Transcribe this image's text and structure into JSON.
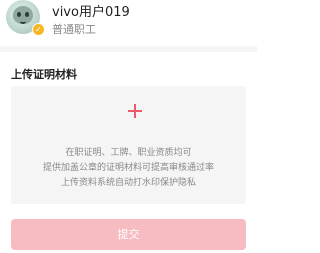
{
  "profile": {
    "username": "vivo用户019",
    "role": "普通职工",
    "avatar_icon": "cartoon-avatar",
    "verify_badge_icon": "verified-badge-icon"
  },
  "upload": {
    "section_title": "上传证明材料",
    "add_icon": "plus-icon",
    "hints": [
      "在职证明、工牌、职业资质均可",
      "提供加盖公章的证明材料可提高审核通过率",
      "上传资料系统自动打水印保护隐私"
    ]
  },
  "submit": {
    "label": "提交"
  },
  "colors": {
    "accent": "#ea5a68",
    "button_disabled": "#f7bcc1",
    "badge": "#f5b722",
    "box_background": "#f5f5f5"
  }
}
